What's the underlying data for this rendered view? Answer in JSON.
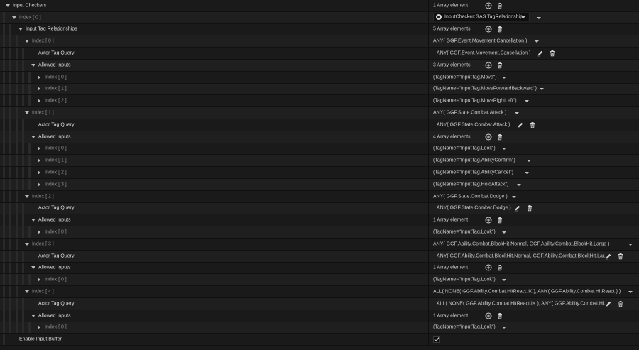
{
  "rows": [
    {
      "name": "input-checkers-row",
      "depth": 0,
      "arrow": "down",
      "label": "Input Checkers",
      "label_style": "white",
      "value": "1 Array element",
      "value_kind": "plain",
      "add": true,
      "del": true
    },
    {
      "name": "index-0-row",
      "depth": 1,
      "arrow": "down",
      "label": "Index [ 0 ]",
      "label_style": "index",
      "value": "InputChecker:GAS TagRelationship",
      "value_kind": "class",
      "combo": false,
      "extra_arrow": true
    },
    {
      "name": "input-tag-relationships-row",
      "depth": 2,
      "arrow": "down",
      "label": "Input Tag Relationships",
      "label_style": "white",
      "value": "5 Array elements",
      "value_kind": "plain",
      "add": true,
      "del": true
    },
    {
      "name": "rel-0-row",
      "depth": 3,
      "arrow": "down",
      "label": "Index [ 0 ]",
      "label_style": "index",
      "value": "ANY( GGF.Event.Movement.Cancellation )",
      "value_kind": "plain",
      "combo": true
    },
    {
      "name": "rel-0-actor-tag-query-row",
      "depth": 4,
      "arrow": "none",
      "label": "Actor Tag Query",
      "label_style": "white",
      "value": "ANY( GGF.Event.Movement.Cancellation )",
      "value_kind": "tq",
      "edit": true,
      "del": true
    },
    {
      "name": "rel-0-allowed-inputs-row",
      "depth": 4,
      "arrow": "down",
      "label": "Allowed Inputs",
      "label_style": "white",
      "value": "3 Array elements",
      "value_kind": "plain",
      "add": true,
      "del": true
    },
    {
      "name": "rel-0-input-0-row",
      "depth": 5,
      "arrow": "right",
      "label": "Index [ 0 ]",
      "label_style": "index",
      "value": "(TagName=\"InputTag.Move\")",
      "value_kind": "plain",
      "combo": true
    },
    {
      "name": "rel-0-input-1-row",
      "depth": 5,
      "arrow": "right",
      "label": "Index [ 1 ]",
      "label_style": "index",
      "value": "(TagName=\"InputTag.MoveForwardBackward\")",
      "value_kind": "plain",
      "combo": true
    },
    {
      "name": "rel-0-input-2-row",
      "depth": 5,
      "arrow": "right",
      "label": "Index [ 2 ]",
      "label_style": "index",
      "value": "(TagName=\"InputTag.MoveRightLeft\")",
      "value_kind": "plain",
      "combo": true
    },
    {
      "name": "rel-1-row",
      "depth": 3,
      "arrow": "down",
      "label": "Index [ 1 ]",
      "label_style": "index",
      "value": "ANY( GGF.State.Combat.Attack )",
      "value_kind": "plain",
      "combo": true
    },
    {
      "name": "rel-1-actor-tag-query-row",
      "depth": 4,
      "arrow": "none",
      "label": "Actor Tag Query",
      "label_style": "white",
      "value": "ANY( GGF.State.Combat.Attack )",
      "value_kind": "tq",
      "edit": true,
      "del": true
    },
    {
      "name": "rel-1-allowed-inputs-row",
      "depth": 4,
      "arrow": "down",
      "label": "Allowed Inputs",
      "label_style": "white",
      "value": "4 Array elements",
      "value_kind": "plain",
      "add": true,
      "del": true
    },
    {
      "name": "rel-1-input-0-row",
      "depth": 5,
      "arrow": "right",
      "label": "Index [ 0 ]",
      "label_style": "index",
      "value": "(TagName=\"InputTag.Look\")",
      "value_kind": "plain",
      "combo": true
    },
    {
      "name": "rel-1-input-1-row",
      "depth": 5,
      "arrow": "right",
      "label": "Index [ 1 ]",
      "label_style": "index",
      "value": "(TagName=\"InputTag.AbilityConfirm\")",
      "value_kind": "plain",
      "combo": true
    },
    {
      "name": "rel-1-input-2-row",
      "depth": 5,
      "arrow": "right",
      "label": "Index [ 2 ]",
      "label_style": "index",
      "value": "(TagName=\"InputTag.AbilityCancel\")",
      "value_kind": "plain",
      "combo": true
    },
    {
      "name": "rel-1-input-3-row",
      "depth": 5,
      "arrow": "right",
      "label": "Index [ 3 ]",
      "label_style": "index",
      "value": "(TagName=\"InputTag.HoldAttack\")",
      "value_kind": "plain",
      "combo": true
    },
    {
      "name": "rel-2-row",
      "depth": 3,
      "arrow": "down",
      "label": "Index [ 2 ]",
      "label_style": "index",
      "value": "ANY( GGF.State.Combat.Dodge )",
      "value_kind": "plain",
      "combo": true
    },
    {
      "name": "rel-2-actor-tag-query-row",
      "depth": 4,
      "arrow": "none",
      "label": "Actor Tag Query",
      "label_style": "white",
      "value": "ANY( GGF.State.Combat.Dodge )",
      "value_kind": "tq",
      "edit": true,
      "del": true
    },
    {
      "name": "rel-2-allowed-inputs-row",
      "depth": 4,
      "arrow": "down",
      "label": "Allowed Inputs",
      "label_style": "white",
      "value": "1 Array element",
      "value_kind": "plain",
      "add": true,
      "del": true
    },
    {
      "name": "rel-2-input-0-row",
      "depth": 5,
      "arrow": "right",
      "label": "Index [ 0 ]",
      "label_style": "index",
      "value": "(TagName=\"InputTag.Look\")",
      "value_kind": "plain",
      "combo": true
    },
    {
      "name": "rel-3-row",
      "depth": 3,
      "arrow": "down",
      "label": "Index [ 3 ]",
      "label_style": "index",
      "value": "ANY( GGF.Ability.Combat.BlockHit.Normal, GGF.Ability.Combat.BlockHit.Large )",
      "value_kind": "plain",
      "combo": true
    },
    {
      "name": "rel-3-actor-tag-query-row",
      "depth": 4,
      "arrow": "none",
      "label": "Actor Tag Query",
      "label_style": "white",
      "value": "ANY( GGF.Ability.Combat.BlockHit.Normal, GGF.Ability.Combat.BlockHit.Lar...",
      "value_kind": "tq",
      "edit": true,
      "del": true
    },
    {
      "name": "rel-3-allowed-inputs-row",
      "depth": 4,
      "arrow": "down",
      "label": "Allowed Inputs",
      "label_style": "white",
      "value": "1 Array element",
      "value_kind": "plain",
      "add": true,
      "del": true
    },
    {
      "name": "rel-3-input-0-row",
      "depth": 5,
      "arrow": "right",
      "label": "Index [ 0 ]",
      "label_style": "index",
      "value": "(TagName=\"InputTag.Look\")",
      "value_kind": "plain",
      "combo": true
    },
    {
      "name": "rel-4-row",
      "depth": 3,
      "arrow": "down",
      "label": "Index [ 4 ]",
      "label_style": "index",
      "value": "ALL( NONE( GGF.Ability.Combat.HitReact.IK ), ANY( GGF.Ability.Combat.HitReact ) )",
      "value_kind": "plain",
      "combo": true
    },
    {
      "name": "rel-4-actor-tag-query-row",
      "depth": 4,
      "arrow": "none",
      "label": "Actor Tag Query",
      "label_style": "white",
      "value": "ALL( NONE( GGF.Ability.Combat.HitReact.IK ), ANY( GGF.Ability.Combat.Hi...",
      "value_kind": "tq",
      "edit": true,
      "del": true
    },
    {
      "name": "rel-4-allowed-inputs-row",
      "depth": 4,
      "arrow": "down",
      "label": "Allowed Inputs",
      "label_style": "white",
      "value": "1 Array element",
      "value_kind": "plain",
      "add": true,
      "del": true
    },
    {
      "name": "rel-4-input-0-row",
      "depth": 5,
      "arrow": "right",
      "label": "Index [ 0 ]",
      "label_style": "index",
      "value": "(TagName=\"InputTag.Look\")",
      "value_kind": "plain",
      "combo": true
    },
    {
      "name": "enable-input-buffer-row",
      "depth": 1,
      "arrow": "none",
      "label": "Enable Input Buffer",
      "label_style": "white",
      "value": "",
      "value_kind": "checkbox",
      "checked": true
    }
  ],
  "colors": {
    "checkbox_mark": "#d0d0d0",
    "accent": "#d0d0d0"
  }
}
